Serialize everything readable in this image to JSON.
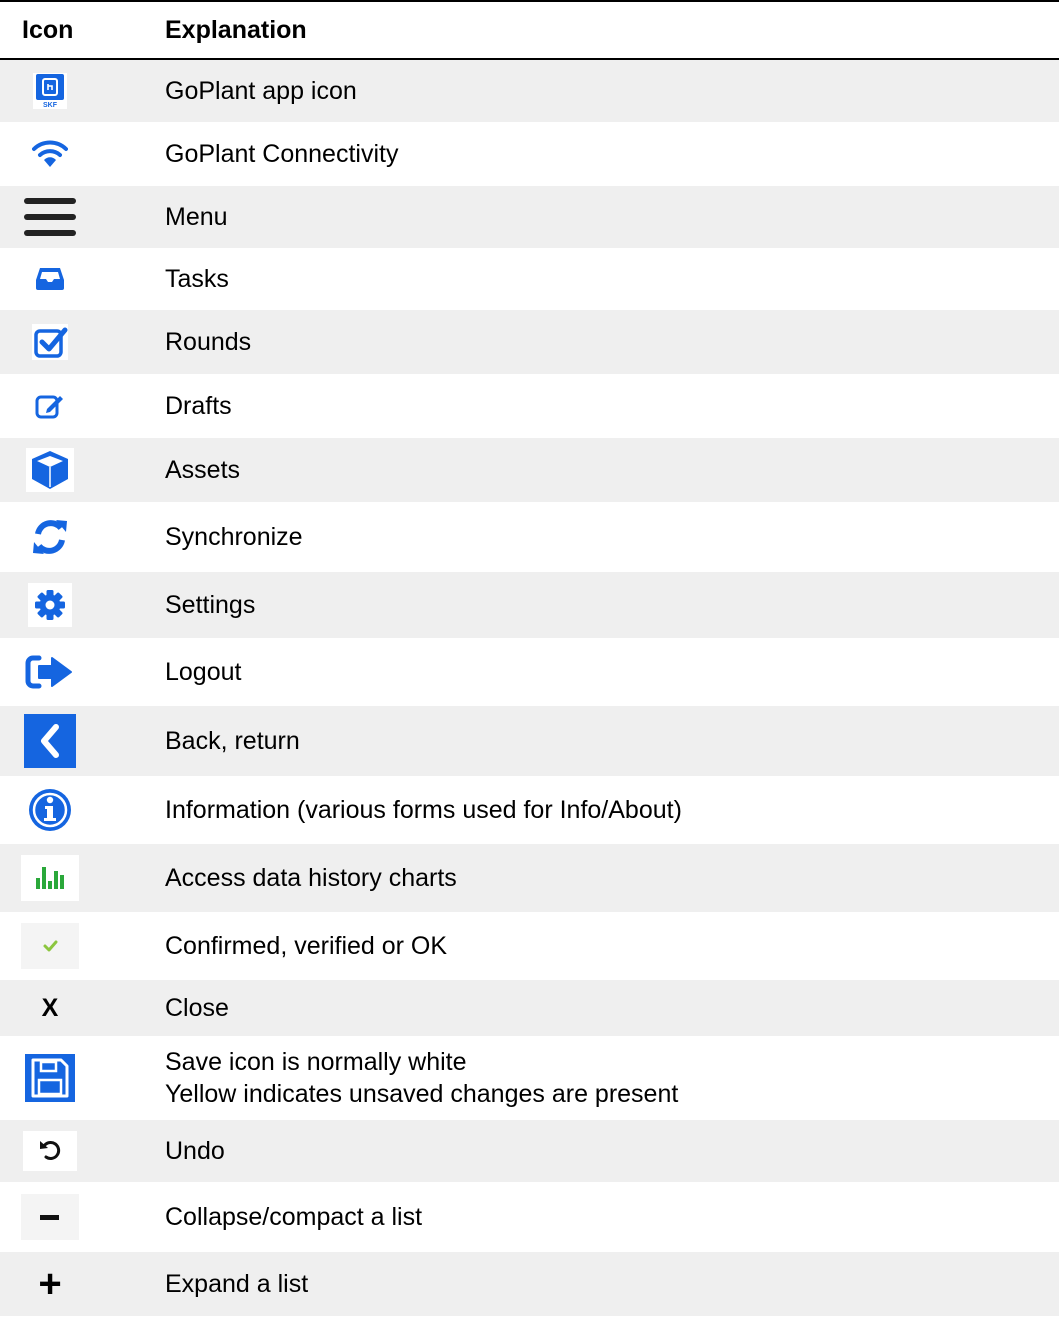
{
  "header": {
    "icon_col": "Icon",
    "explanation_col": "Explanation"
  },
  "rows": [
    {
      "icon": "goplant-app-icon",
      "label": "GoPlant app icon",
      "logo_text": "SKF"
    },
    {
      "icon": "wifi-icon",
      "label": "GoPlant Connectivity"
    },
    {
      "icon": "menu-icon",
      "label": "Menu"
    },
    {
      "icon": "inbox-icon",
      "label": "Tasks"
    },
    {
      "icon": "checkbox-icon",
      "label": "Rounds"
    },
    {
      "icon": "edit-icon",
      "label": "Drafts"
    },
    {
      "icon": "cube-icon",
      "label": "Assets"
    },
    {
      "icon": "sync-icon",
      "label": "Synchronize"
    },
    {
      "icon": "gear-icon",
      "label": "Settings"
    },
    {
      "icon": "logout-icon",
      "label": "Logout"
    },
    {
      "icon": "chevron-left-icon",
      "label": "Back, return"
    },
    {
      "icon": "info-icon",
      "label": "Information (various forms used for Info/About)"
    },
    {
      "icon": "bar-chart-icon",
      "label": "Access data history charts"
    },
    {
      "icon": "check-icon",
      "label": "Confirmed, verified or OK"
    },
    {
      "icon": "close-icon",
      "label": "Close",
      "glyph": "X"
    },
    {
      "icon": "save-icon",
      "label": "Save icon is normally white",
      "label2": "Yellow indicates unsaved changes are present"
    },
    {
      "icon": "undo-icon",
      "label": "Undo"
    },
    {
      "icon": "minus-icon",
      "label": "Collapse/compact a list"
    },
    {
      "icon": "plus-icon",
      "label": "Expand a list",
      "glyph": "+"
    }
  ],
  "colors": {
    "blue": "#1565e0",
    "green": "#2aa83a",
    "check_green": "#8cc63f",
    "alt_row": "#efefef"
  }
}
